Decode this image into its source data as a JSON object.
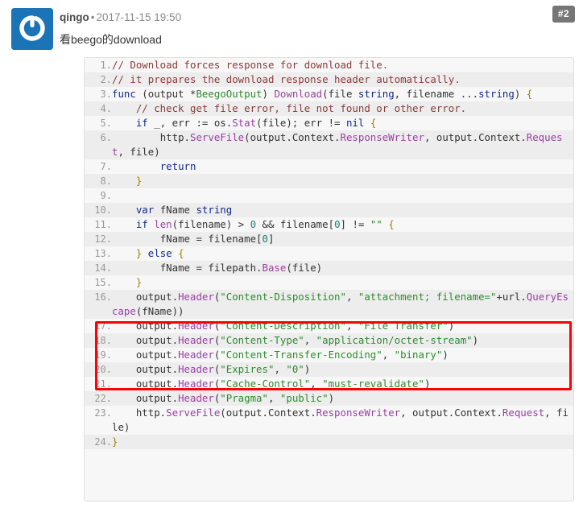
{
  "comment": {
    "author": "qingo",
    "separator": "•",
    "timestamp": "2017-11-15 19:50",
    "index_badge": "#2",
    "body_text": "看beego的download",
    "avatar_icon": "gitea-power-logo-icon",
    "avatar_color": "#1a74b5",
    "badge_color": "#767676"
  },
  "code": {
    "language": "go",
    "highlight_box_color": "#fb0007",
    "background": "#f7f7f7",
    "alt_row_background": "#ededed",
    "lines": [
      {
        "n": "1.",
        "tokens": [
          {
            "t": "cm",
            "v": "// Download forces response for download file."
          }
        ]
      },
      {
        "n": "2.",
        "tokens": [
          {
            "t": "cm",
            "v": "// it prepares the download response header automatically."
          }
        ]
      },
      {
        "n": "3.",
        "tokens": [
          {
            "t": "k",
            "v": "func"
          },
          {
            "t": "p",
            "v": " (output *"
          },
          {
            "t": "s",
            "v": "BeegoOutput"
          },
          {
            "t": "p",
            "v": ") "
          },
          {
            "t": "fn",
            "v": "Download"
          },
          {
            "t": "p",
            "v": "(file "
          },
          {
            "t": "k",
            "v": "string"
          },
          {
            "t": "p",
            "v": ", filename ..."
          },
          {
            "t": "k",
            "v": "string"
          },
          {
            "t": "p",
            "v": ") "
          },
          {
            "t": "b",
            "v": "{"
          }
        ]
      },
      {
        "n": "4.",
        "tokens": [
          {
            "t": "p",
            "v": "    "
          },
          {
            "t": "cm",
            "v": "// check get file error, file not found or other error."
          }
        ]
      },
      {
        "n": "5.",
        "tokens": [
          {
            "t": "p",
            "v": "    "
          },
          {
            "t": "k",
            "v": "if"
          },
          {
            "t": "p",
            "v": " _, err := os."
          },
          {
            "t": "fn",
            "v": "Stat"
          },
          {
            "t": "p",
            "v": "(file); err != "
          },
          {
            "t": "k",
            "v": "nil"
          },
          {
            "t": "p",
            "v": " "
          },
          {
            "t": "b",
            "v": "{"
          }
        ]
      },
      {
        "n": "6.",
        "tokens": [
          {
            "t": "p",
            "v": "        http."
          },
          {
            "t": "fn",
            "v": "ServeFile"
          },
          {
            "t": "p",
            "v": "(output.Context."
          },
          {
            "t": "fn",
            "v": "ResponseWriter"
          },
          {
            "t": "p",
            "v": ", output.Context."
          },
          {
            "t": "fn",
            "v": "Request"
          },
          {
            "t": "p",
            "v": ", file)"
          }
        ]
      },
      {
        "n": "7.",
        "tokens": [
          {
            "t": "p",
            "v": "        "
          },
          {
            "t": "k",
            "v": "return"
          }
        ]
      },
      {
        "n": "8.",
        "tokens": [
          {
            "t": "p",
            "v": "    "
          },
          {
            "t": "b",
            "v": "}"
          }
        ]
      },
      {
        "n": "9.",
        "tokens": [
          {
            "t": "p",
            "v": ""
          }
        ]
      },
      {
        "n": "10.",
        "tokens": [
          {
            "t": "p",
            "v": "    "
          },
          {
            "t": "k",
            "v": "var"
          },
          {
            "t": "p",
            "v": " fName "
          },
          {
            "t": "k",
            "v": "string"
          }
        ]
      },
      {
        "n": "11.",
        "tokens": [
          {
            "t": "p",
            "v": "    "
          },
          {
            "t": "k",
            "v": "if"
          },
          {
            "t": "p",
            "v": " "
          },
          {
            "t": "fn",
            "v": "len"
          },
          {
            "t": "p",
            "v": "(filename) > "
          },
          {
            "t": "n",
            "v": "0"
          },
          {
            "t": "p",
            "v": " && filename["
          },
          {
            "t": "n",
            "v": "0"
          },
          {
            "t": "p",
            "v": "] != "
          },
          {
            "t": "s",
            "v": "\"\""
          },
          {
            "t": "p",
            "v": " "
          },
          {
            "t": "b",
            "v": "{"
          }
        ]
      },
      {
        "n": "12.",
        "tokens": [
          {
            "t": "p",
            "v": "        fName = filename["
          },
          {
            "t": "n",
            "v": "0"
          },
          {
            "t": "p",
            "v": "]"
          }
        ]
      },
      {
        "n": "13.",
        "tokens": [
          {
            "t": "p",
            "v": "    "
          },
          {
            "t": "b",
            "v": "}"
          },
          {
            "t": "p",
            "v": " "
          },
          {
            "t": "k",
            "v": "else"
          },
          {
            "t": "p",
            "v": " "
          },
          {
            "t": "b",
            "v": "{"
          }
        ]
      },
      {
        "n": "14.",
        "tokens": [
          {
            "t": "p",
            "v": "        fName = filepath."
          },
          {
            "t": "fn",
            "v": "Base"
          },
          {
            "t": "p",
            "v": "(file)"
          }
        ]
      },
      {
        "n": "15.",
        "tokens": [
          {
            "t": "p",
            "v": "    "
          },
          {
            "t": "b",
            "v": "}"
          }
        ]
      },
      {
        "n": "16.",
        "tokens": [
          {
            "t": "p",
            "v": "    output."
          },
          {
            "t": "fn",
            "v": "Header"
          },
          {
            "t": "p",
            "v": "("
          },
          {
            "t": "s",
            "v": "\"Content-Disposition\""
          },
          {
            "t": "p",
            "v": ", "
          },
          {
            "t": "s",
            "v": "\"attachment; filename=\""
          },
          {
            "t": "p",
            "v": "+url."
          },
          {
            "t": "fn",
            "v": "QueryEscape"
          },
          {
            "t": "p",
            "v": "(fName))"
          }
        ]
      },
      {
        "n": "17.",
        "tokens": [
          {
            "t": "p",
            "v": "    output."
          },
          {
            "t": "fn",
            "v": "Header"
          },
          {
            "t": "p",
            "v": "("
          },
          {
            "t": "s",
            "v": "\"Content-Description\""
          },
          {
            "t": "p",
            "v": ", "
          },
          {
            "t": "s",
            "v": "\"File Transfer\""
          },
          {
            "t": "p",
            "v": ")"
          }
        ]
      },
      {
        "n": "18.",
        "tokens": [
          {
            "t": "p",
            "v": "    output."
          },
          {
            "t": "fn",
            "v": "Header"
          },
          {
            "t": "p",
            "v": "("
          },
          {
            "t": "s",
            "v": "\"Content-Type\""
          },
          {
            "t": "p",
            "v": ", "
          },
          {
            "t": "s",
            "v": "\"application/octet-stream\""
          },
          {
            "t": "p",
            "v": ")"
          }
        ]
      },
      {
        "n": "19.",
        "tokens": [
          {
            "t": "p",
            "v": "    output."
          },
          {
            "t": "fn",
            "v": "Header"
          },
          {
            "t": "p",
            "v": "("
          },
          {
            "t": "s",
            "v": "\"Content-Transfer-Encoding\""
          },
          {
            "t": "p",
            "v": ", "
          },
          {
            "t": "s",
            "v": "\"binary\""
          },
          {
            "t": "p",
            "v": ")"
          }
        ]
      },
      {
        "n": "20.",
        "tokens": [
          {
            "t": "p",
            "v": "    output."
          },
          {
            "t": "fn",
            "v": "Header"
          },
          {
            "t": "p",
            "v": "("
          },
          {
            "t": "s",
            "v": "\"Expires\""
          },
          {
            "t": "p",
            "v": ", "
          },
          {
            "t": "s",
            "v": "\"0\""
          },
          {
            "t": "p",
            "v": ")"
          }
        ]
      },
      {
        "n": "21.",
        "tokens": [
          {
            "t": "p",
            "v": "    output."
          },
          {
            "t": "fn",
            "v": "Header"
          },
          {
            "t": "p",
            "v": "("
          },
          {
            "t": "s",
            "v": "\"Cache-Control\""
          },
          {
            "t": "p",
            "v": ", "
          },
          {
            "t": "s",
            "v": "\"must-revalidate\""
          },
          {
            "t": "p",
            "v": ")"
          }
        ]
      },
      {
        "n": "22.",
        "tokens": [
          {
            "t": "p",
            "v": "    output."
          },
          {
            "t": "fn",
            "v": "Header"
          },
          {
            "t": "p",
            "v": "("
          },
          {
            "t": "s",
            "v": "\"Pragma\""
          },
          {
            "t": "p",
            "v": ", "
          },
          {
            "t": "s",
            "v": "\"public\""
          },
          {
            "t": "p",
            "v": ")"
          }
        ]
      },
      {
        "n": "23.",
        "tokens": [
          {
            "t": "p",
            "v": "    http."
          },
          {
            "t": "fn",
            "v": "ServeFile"
          },
          {
            "t": "p",
            "v": "(output.Context."
          },
          {
            "t": "fn",
            "v": "ResponseWriter"
          },
          {
            "t": "p",
            "v": ", output.Context."
          },
          {
            "t": "fn",
            "v": "Request"
          },
          {
            "t": "p",
            "v": ", file)"
          }
        ]
      },
      {
        "n": "24.",
        "tokens": [
          {
            "t": "b",
            "v": "}"
          }
        ]
      }
    ]
  }
}
